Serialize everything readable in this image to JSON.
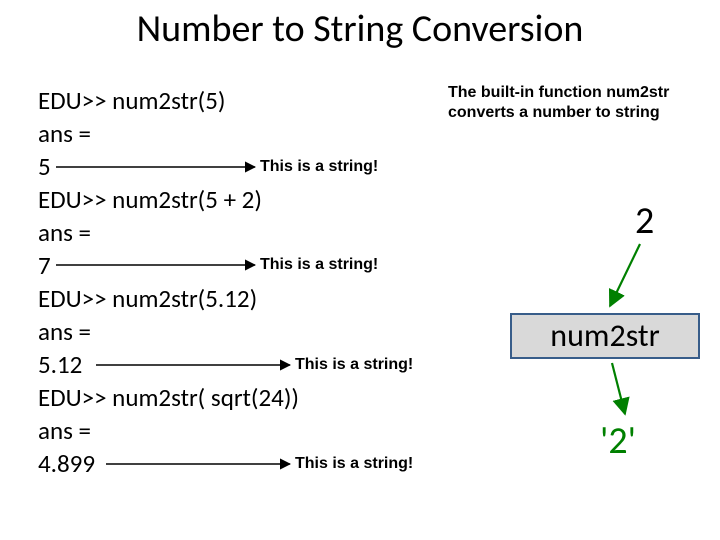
{
  "title": "Number to String  Conversion",
  "code": {
    "l1": "EDU>> num2str(5)",
    "l2": "ans =",
    "l3": "5",
    "l4": "EDU>> num2str(5 + 2)",
    "l5": "ans =",
    "l6": "7",
    "l7": "EDU>> num2str(5.12)",
    "l8": "ans =",
    "l9": "5.12",
    "l10": "EDU>> num2str( sqrt(24))",
    "l11": "ans =",
    "l12": "4.899"
  },
  "annot": {
    "a1": "This is a string!",
    "a2": "This is a string!",
    "a3": "This is a string!",
    "a4": "This is a string!"
  },
  "desc": "The built-in function num2str converts a number to string",
  "diagram": {
    "input": "2",
    "func": "num2str",
    "output": "'2'"
  }
}
